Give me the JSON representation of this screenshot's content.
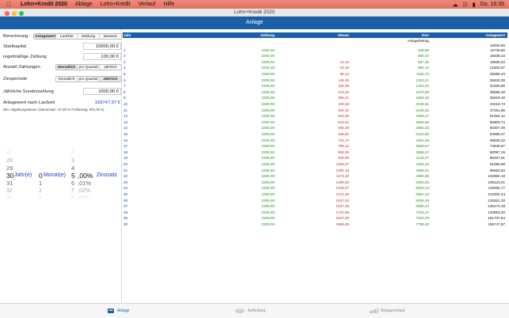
{
  "menubar": {
    "app": "Lohn+Kredit 2020",
    "items": [
      "Ablage",
      "Lohn+Kredit",
      "Verlauf",
      "Hilfe"
    ],
    "right": "Do. 16:35"
  },
  "window": {
    "title": "Lohn+Kredit 2020"
  },
  "nav": {
    "title": "Anlage"
  },
  "left": {
    "berechnung_label": "Berechnung",
    "tabs": [
      "Anlagewert",
      "Laufzeit",
      "Zahlung",
      "Barwert"
    ],
    "selected_tab": 0,
    "startkapital_label": "Startkapital",
    "startkapital_value": "10000,00 €",
    "regzahlung_label": "regelmäßige Zahlung",
    "regzahlung_value": "100,00 €",
    "anzahl_label": "Anzahl Zahlungen",
    "zinsperiode_label": "Zinsperiode",
    "period_options": [
      "Monatlich",
      "pro Quartal",
      "Jährlich"
    ],
    "anzahl_selected": 0,
    "zinsperiode_selected": 2,
    "sonder_label": "Jährliche Sonderzahlung",
    "sonder_value": "1000,00 €",
    "result_label": "Anlagewert nach Laufzeit",
    "result_value": "159747,97 €",
    "tax_note": "inkl. Abgeltungssteuer (Steuersatz: 27,99 % Freibetrag: 801,00 €)",
    "picker": {
      "years": [
        "27",
        "28",
        "29",
        "30",
        "31",
        "32",
        "33"
      ],
      "months": [
        "",
        "",
        "",
        "0",
        "1",
        "2",
        "3"
      ],
      "rates": [
        "2",
        "3",
        "4",
        "5",
        "6",
        "7",
        "8"
      ],
      "rate_decimals": [
        "",
        "",
        "",
        ",00%",
        ",01%",
        ",02%",
        ",03%"
      ],
      "year_label": "Jahr(e)",
      "month_label": "Monat(e)",
      "rate_label": "Zinssatz"
    }
  },
  "table": {
    "columns": [
      "Jahr",
      "Zahlung",
      "Steuer",
      "Zins",
      "Anlagewert"
    ],
    "start_label": "Anlagebetrag",
    "start_value": "10000,00",
    "rows": [
      [
        "1",
        "2200,00",
        "",
        "548,80",
        "12748,80"
      ],
      [
        "2",
        "2200,00",
        "",
        "689,43",
        "15638,23"
      ],
      [
        "3",
        "2200,00",
        "10,15",
        "837,26",
        "18665,34"
      ],
      [
        "4",
        "2200,00",
        "53,49",
        "992,12",
        "21803,97"
      ],
      [
        "5",
        "2200,00",
        "98,44",
        "1152,70",
        "25058,23"
      ],
      [
        "6",
        "2200,00",
        "145,05",
        "1319,21",
        "28432,39"
      ],
      [
        "7",
        "2200,00",
        "193,38",
        "1491,82",
        "31930,85"
      ],
      [
        "8",
        "2200,00",
        "243,46",
        "1670,80",
        "35558,19"
      ],
      [
        "9",
        "2200,00",
        "295,41",
        "1856,40",
        "39319,18"
      ],
      [
        "10",
        "2200,00",
        "349,26",
        "2048,81",
        "43218,73"
      ],
      [
        "11",
        "2200,00",
        "405,10",
        "2248,32",
        "47261,95"
      ],
      [
        "12",
        "2200,00",
        "463,00",
        "2455,17",
        "51454,12"
      ],
      [
        "13",
        "2200,00",
        "523,04",
        "2669,66",
        "55800,74"
      ],
      [
        "14",
        "2200,00",
        "585,28",
        "2892,03",
        "60307,49"
      ],
      [
        "15",
        "2200,00",
        "649,82",
        "3122,60",
        "64980,27"
      ],
      [
        "16",
        "2200,00",
        "716,74",
        "3361,69",
        "69825,22"
      ],
      [
        "17",
        "2200,00",
        "786,12",
        "3609,57",
        "74848,67"
      ],
      [
        "18",
        "2200,00",
        "858,05",
        "3866,57",
        "80057,19"
      ],
      [
        "19",
        "2200,00",
        "932,65",
        "4133,07",
        "85457,61"
      ],
      [
        "20",
        "2200,00",
        "1009,97",
        "4409,34",
        "91056,98"
      ],
      [
        "21",
        "2200,00",
        "1090,18",
        "4695,81",
        "96862,63"
      ],
      [
        "22",
        "2200,00",
        "1173,30",
        "4992,85",
        "102882,18"
      ],
      [
        "23",
        "2200,00",
        "1259,50",
        "5300,83",
        "109123,51"
      ],
      [
        "24",
        "2200,00",
        "1348,87",
        "5620,13",
        "115594,77"
      ],
      [
        "25",
        "2200,00",
        "1441,55",
        "5951,22",
        "122304,44"
      ],
      [
        "26",
        "2200,00",
        "1537,63",
        "6294,49",
        "129261,30"
      ],
      [
        "27",
        "2200,00",
        "1637,26",
        "6650,44",
        "136474,48"
      ],
      [
        "28",
        "2200,00",
        "1740,55",
        "7019,47",
        "143953,40"
      ],
      [
        "29",
        "2200,00",
        "1847,69",
        "7402,09",
        "151707,84"
      ],
      [
        "30",
        "2200,00",
        "1958,69",
        "7798,82",
        "159747,97"
      ]
    ]
  },
  "tabbar": {
    "items": [
      "Anlage",
      "Aufteilung",
      "Anlageverlauf"
    ],
    "selected": 0
  },
  "colors": {
    "accent": "#1a5fa8",
    "positive": "#2a8a2a",
    "negative": "#c03030"
  }
}
